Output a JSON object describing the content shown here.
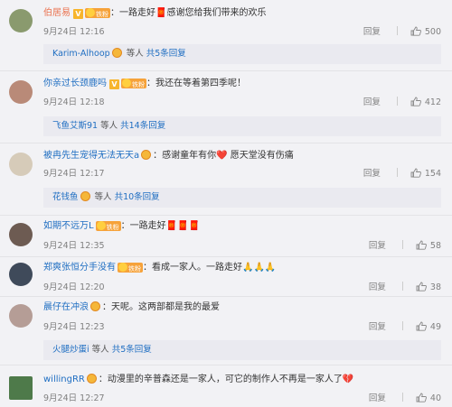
{
  "comments": [
    {
      "name": "伯居易",
      "has_v": true,
      "fan_label": "铁粉",
      "text": "：一路走好🧧感谢您给我们带来的欢乐",
      "time": "9月24日 12:16",
      "reply_label": "回复",
      "likes": "500",
      "replies": {
        "who": "Karim-Alhoop",
        "mid": " 等人 ",
        "count": "共5条回复"
      }
    },
    {
      "name": "你亲过长颈鹿吗",
      "has_v": true,
      "fan_label": "铁粉",
      "text": "：我还在等着第四季呢！",
      "time": "9月24日 12:18",
      "reply_label": "回复",
      "likes": "412",
      "replies": {
        "who": "飞鱼艾斯91",
        "mid": " 等人 ",
        "count": "共14条回复"
      }
    },
    {
      "name": "被冉先生宠得无法无天a",
      "has_v": false,
      "fan_label": "",
      "text": "：感谢童年有你❤️ 愿天堂没有伤痛",
      "time": "9月24日 12:17",
      "reply_label": "回复",
      "likes": "154",
      "replies": {
        "who": "花钱鱼",
        "mid": " 等人 ",
        "count": "共10条回复"
      }
    },
    {
      "name": "如期不远万L",
      "has_v": false,
      "fan_label": "铁粉",
      "text": "：一路走好🧧🧧🧧",
      "time": "9月24日 12:35",
      "reply_label": "回复",
      "likes": "58"
    },
    {
      "name": "郑爽张恒分手没有",
      "has_v": false,
      "fan_label": "铁粉",
      "text": "：看成一家人。一路走好🙏🙏🙏",
      "time": "9月24日 12:20",
      "reply_label": "回复",
      "likes": "38"
    },
    {
      "name": "晨仔在冲浪",
      "has_v": false,
      "fan_label": "",
      "text": "：天呢。这两部都是我的最爱",
      "time": "9月24日 12:23",
      "reply_label": "回复",
      "likes": "49",
      "replies": {
        "who": "火腿炒蛋i",
        "mid": " 等人 ",
        "count": "共5条回复"
      }
    },
    {
      "name": "willingRR",
      "has_v": false,
      "fan_label": "",
      "text": "：动漫里的辛普森还是一家人，可它的制作人不再是一家人了💔",
      "time": "9月24日 12:27",
      "reply_label": "回复",
      "likes": "40"
    }
  ]
}
